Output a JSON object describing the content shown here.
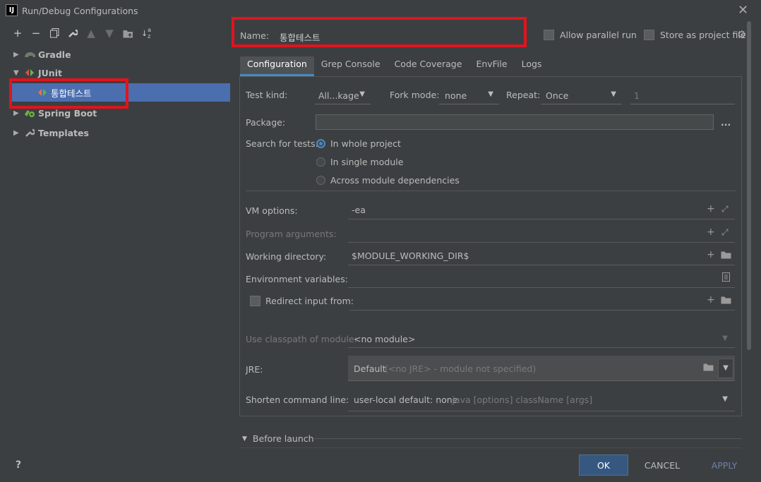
{
  "window": {
    "title": "Run/Debug Configurations",
    "logo_text": "IJ"
  },
  "tree": {
    "items": [
      {
        "label": "Gradle",
        "icon": "gradle-elephant-icon",
        "expanded": false
      },
      {
        "label": "JUnit",
        "icon": "junit-icon",
        "expanded": true
      },
      {
        "label": "통합테스트",
        "icon": "junit-test-icon",
        "selected": true
      },
      {
        "label": "Spring Boot",
        "icon": "spring-boot-icon",
        "expanded": false
      },
      {
        "label": "Templates",
        "icon": "wrench-icon",
        "expanded": false
      }
    ]
  },
  "header": {
    "name_label": "Name:",
    "name_value": "통합테스트",
    "allow_parallel_label": "Allow parallel run",
    "store_project_label": "Store as project file"
  },
  "tabs": [
    "Configuration",
    "Grep Console",
    "Code Coverage",
    "EnvFile",
    "Logs"
  ],
  "config": {
    "test_kind_label": "Test kind:",
    "test_kind_value": "All...kage",
    "fork_mode_label": "Fork mode:",
    "fork_mode_value": "none",
    "repeat_label": "Repeat:",
    "repeat_value": "Once",
    "repeat_count": "1",
    "package_label": "Package:",
    "package_value": "",
    "browse_label": "...",
    "search_label": "Search for tests:",
    "search_options": [
      "In whole project",
      "In single module",
      "Across module dependencies"
    ],
    "vm_options_label": "VM options:",
    "vm_options_value": "-ea",
    "program_args_label": "Program arguments:",
    "program_args_value": "",
    "working_dir_label": "Working directory:",
    "working_dir_value": "$MODULE_WORKING_DIR$",
    "env_vars_label": "Environment variables:",
    "env_vars_value": "",
    "redirect_label": "Redirect input from:",
    "classpath_label": "Use classpath of module:",
    "classpath_value": "<no module>",
    "jre_label": "JRE:",
    "jre_value": "Default",
    "jre_hint": "(<no JRE> - module not specified)",
    "shorten_label": "Shorten command line:",
    "shorten_value": "user-local default: none",
    "shorten_hint": "- java [options] className [args]"
  },
  "before_launch_label": "Before launch",
  "buttons": {
    "help": "?",
    "ok": "OK",
    "cancel": "CANCEL",
    "apply": "APPLY"
  },
  "colors": {
    "background": "#3c3f41",
    "selection": "#4b6eaf",
    "accent": "#4a88c7",
    "highlight_box": "#e0141e",
    "ok_button": "#365880"
  }
}
